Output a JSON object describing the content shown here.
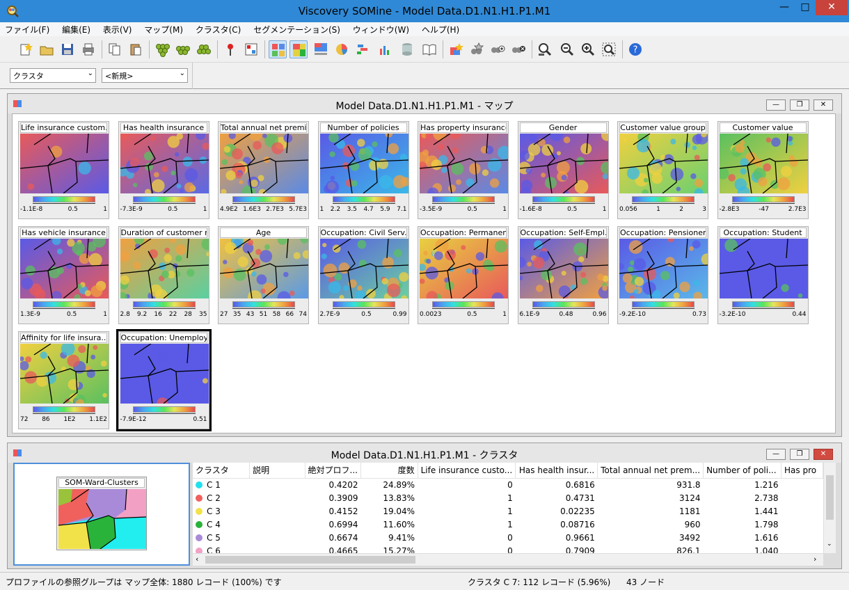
{
  "window": {
    "title": "Viscovery SOMine - Model Data.D1.N1.H1.P1.M1"
  },
  "menu": [
    "ファイル(F)",
    "編集(E)",
    "表示(V)",
    "マップ(M)",
    "クラスタ(C)",
    "セグメンテーション(S)",
    "ウィンドウ(W)",
    "ヘルプ(H)"
  ],
  "combos": {
    "left": "クラスタ",
    "right": "<新規>"
  },
  "map_window": {
    "title": "Model Data.D1.N1.H1.P1.M1 - マップ",
    "tiles": [
      {
        "name": "Life insurance custom...",
        "ticks": [
          "-1.1E-8",
          "0.5",
          "1"
        ]
      },
      {
        "name": "Has health insurance",
        "ticks": [
          "-7.3E-9",
          "0.5",
          "1"
        ]
      },
      {
        "name": "Total annual net premi...",
        "ticks": [
          "4.9E2",
          "1.6E3",
          "2.7E3",
          "5.7E3"
        ]
      },
      {
        "name": "Number of policies",
        "ticks": [
          "1",
          "2.2",
          "3.5",
          "4.7",
          "5.9",
          "7.1"
        ]
      },
      {
        "name": "Has property insurance",
        "ticks": [
          "-3.5E-9",
          "0.5",
          "1"
        ]
      },
      {
        "name": "Gender",
        "ticks": [
          "-1.6E-8",
          "0.5",
          "1"
        ]
      },
      {
        "name": "Customer value group",
        "ticks": [
          "0.056",
          "1",
          "2",
          "3"
        ]
      },
      {
        "name": "Customer value",
        "ticks": [
          "-2.8E3",
          "-47",
          "2.7E3"
        ]
      },
      {
        "name": "Has vehicle insurance",
        "ticks": [
          "1.3E-9",
          "0.5",
          "1"
        ]
      },
      {
        "name": "Duration of customer r...",
        "ticks": [
          "2.8",
          "9.2",
          "16",
          "22",
          "28",
          "35"
        ]
      },
      {
        "name": "Age",
        "ticks": [
          "27",
          "35",
          "43",
          "51",
          "58",
          "66",
          "74"
        ]
      },
      {
        "name": "Occupation: Civil Serv...",
        "ticks": [
          "2.7E-9",
          "0.5",
          "0.99"
        ]
      },
      {
        "name": "Occupation: Permanent",
        "ticks": [
          "0.0023",
          "0.5",
          "1"
        ]
      },
      {
        "name": "Occupation: Self-Empl...",
        "ticks": [
          "6.1E-9",
          "0.48",
          "0.96"
        ]
      },
      {
        "name": "Occupation: Pensioner",
        "ticks": [
          "-9.2E-10",
          "0.73"
        ]
      },
      {
        "name": "Occupation: Student",
        "ticks": [
          "-3.2E-10",
          "0.44"
        ]
      },
      {
        "name": "Affinity for life insura...",
        "ticks": [
          "72",
          "86",
          "1E2",
          "1.1E2"
        ]
      },
      {
        "name": "Occupation: Unemploy...",
        "ticks": [
          "-7.9E-12",
          "0.51"
        ]
      }
    ]
  },
  "cluster_window": {
    "title": "Model Data.D1.N1.H1.P1.M1 - クラスタ",
    "preview_label": "SOM-Ward-Clusters",
    "headers": [
      "クラスタ",
      "説明",
      "絶対プロフ...",
      "度数",
      "Life insurance custo...",
      "Has health insur...",
      "Total annual net prem...",
      "Number of poli...",
      "Has pro"
    ],
    "rows": [
      {
        "name": "C 1",
        "color": "#22e0ee",
        "desc": "",
        "abs": "0.4202",
        "freq": "24.89%",
        "life": "0",
        "health": "0.6816",
        "prem": "931.8",
        "pol": "1.216"
      },
      {
        "name": "C 2",
        "color": "#f0605c",
        "desc": "",
        "abs": "0.3909",
        "freq": "13.83%",
        "life": "1",
        "health": "0.4731",
        "prem": "3124",
        "pol": "2.738"
      },
      {
        "name": "C 3",
        "color": "#f2e24a",
        "desc": "",
        "abs": "0.4152",
        "freq": "19.04%",
        "life": "1",
        "health": "0.02235",
        "prem": "1181",
        "pol": "1.441"
      },
      {
        "name": "C 4",
        "color": "#2ab33a",
        "desc": "",
        "abs": "0.6994",
        "freq": "11.60%",
        "life": "1",
        "health": "0.08716",
        "prem": "960",
        "pol": "1.798"
      },
      {
        "name": "C 5",
        "color": "#a98ad8",
        "desc": "",
        "abs": "0.6674",
        "freq": "9.41%",
        "life": "0",
        "health": "0.9661",
        "prem": "3492",
        "pol": "1.616"
      },
      {
        "name": "C 6",
        "color": "#f2a0c4",
        "desc": "",
        "abs": "0.4665",
        "freq": "15.27%",
        "life": "0",
        "health": "0.7909",
        "prem": "826.1",
        "pol": "1.040"
      }
    ]
  },
  "status": {
    "left": "プロファイルの参照グループは マップ全体: 1880 レコード (100%) です",
    "middle": "クラスタ C 7: 112 レコード (5.96%)",
    "right": "43 ノード"
  }
}
